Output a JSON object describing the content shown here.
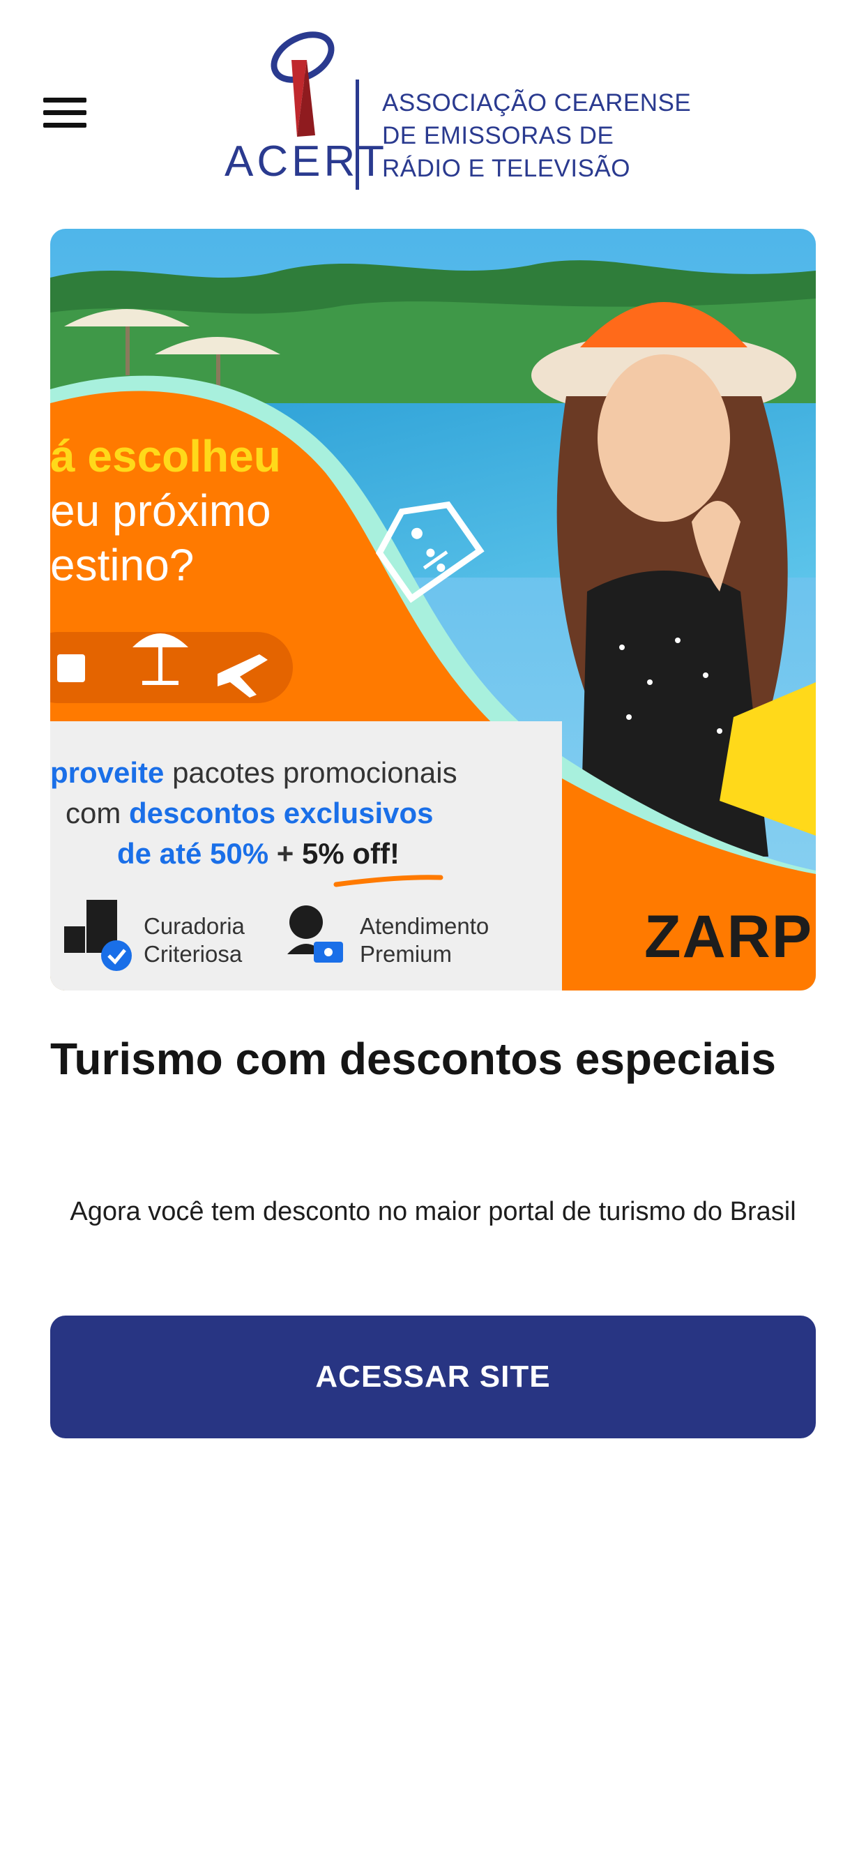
{
  "header": {
    "menu_icon": "hamburger-menu-icon",
    "logo": {
      "short_name": "ACERT",
      "lines": [
        "ASSOCIAÇÃO CEARENSE",
        "DE EMISSORAS DE",
        "RÁDIO E TELEVISÃO"
      ],
      "color": "#2a3a8f",
      "accent_color": "#c0282d"
    }
  },
  "banner": {
    "headline": [
      "á escolheu",
      "eu próximo",
      "estino?"
    ],
    "promo_prefix": "proveite",
    "promo_line1_rest": "pacotes promocionais",
    "promo_line2_prefix": "com",
    "promo_line2_highlight": "descontos exclusivos",
    "promo_line3_highlight": "de até 50%",
    "promo_line3_plus": "+",
    "promo_line3_extra": "5% off!",
    "features": [
      {
        "icon": "building-check-icon",
        "line1": "Curadoria",
        "line2": "Criteriosa"
      },
      {
        "icon": "support-agent-icon",
        "line1": "Atendimento",
        "line2": "Premium"
      }
    ],
    "brand": "ZARP",
    "colors": {
      "orange": "#ff7a00",
      "yellow": "#ffd91a",
      "blue": "#1a6fe8",
      "pool": "#39a9dc"
    }
  },
  "card": {
    "title": "Turismo com descontos especiais",
    "description": "Agora você tem desconto no maior portal de turismo do Brasil",
    "cta_label": "ACESSAR SITE",
    "cta_color": "#283583"
  }
}
